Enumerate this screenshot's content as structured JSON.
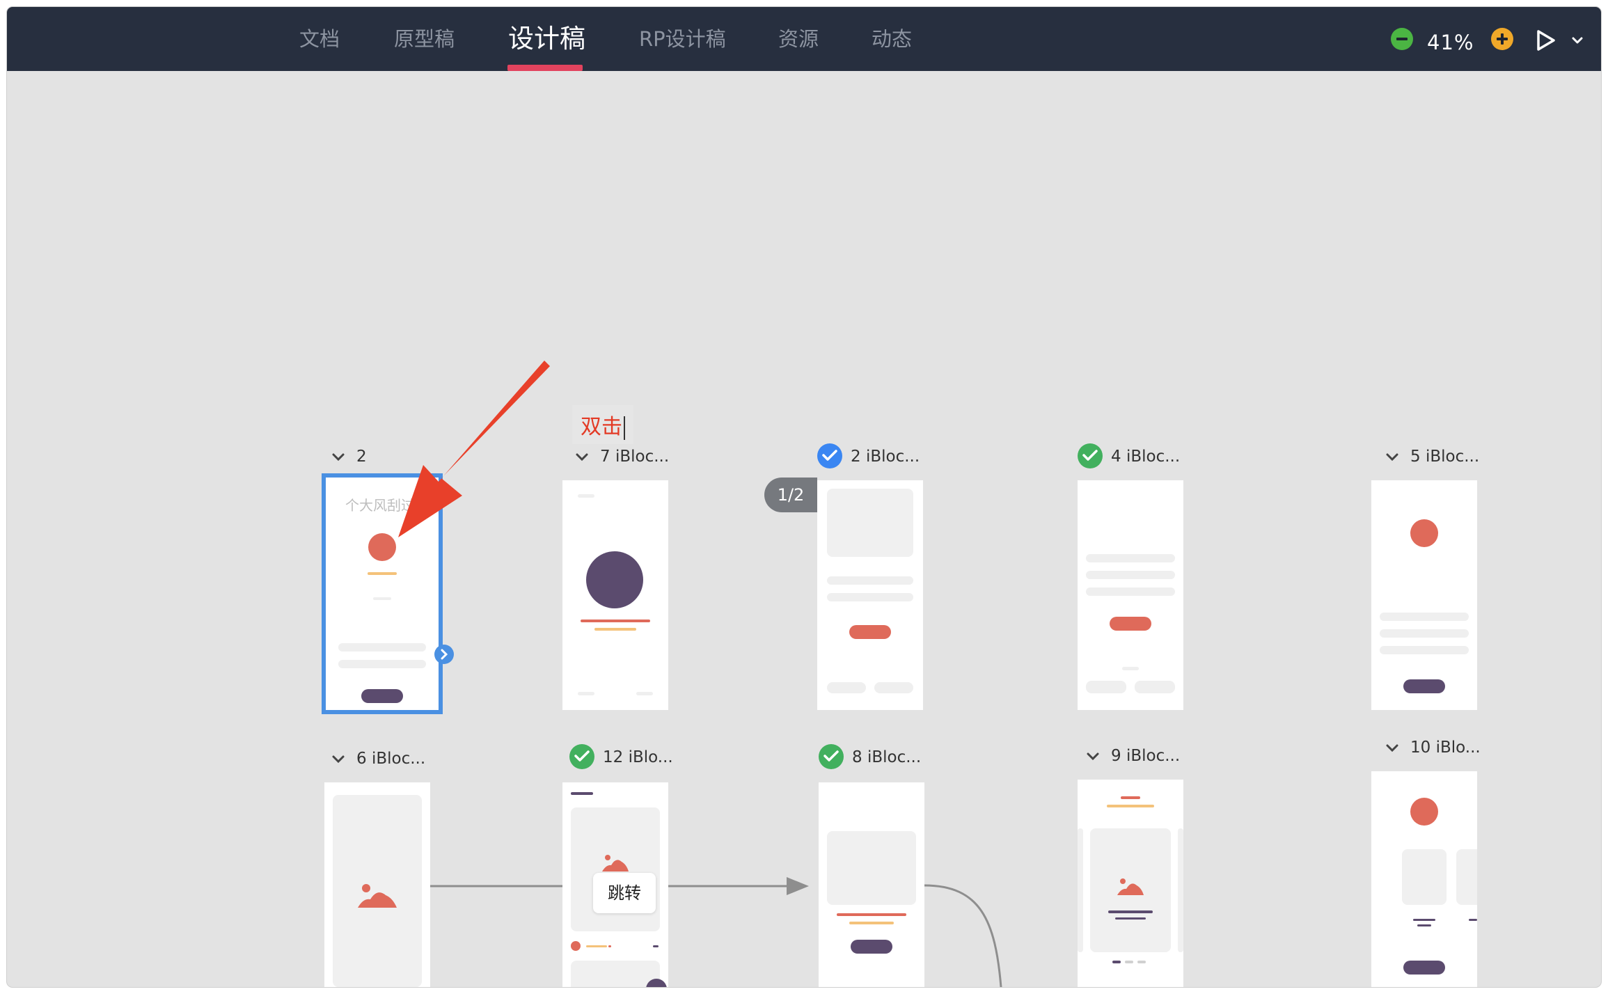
{
  "tabs": [
    {
      "label": "文档",
      "active": false
    },
    {
      "label": "原型稿",
      "active": false
    },
    {
      "label": "设计稿",
      "active": true
    },
    {
      "label": "RP设计稿",
      "active": false
    },
    {
      "label": "资源",
      "active": false
    },
    {
      "label": "动态",
      "active": false
    }
  ],
  "zoom": {
    "value": "41%",
    "minus_icon": "zoom-out-icon",
    "plus_icon": "zoom-in-icon"
  },
  "annotation": {
    "text": "双击",
    "color": "#e33a25"
  },
  "frames": [
    {
      "title": "2",
      "status": "none"
    },
    {
      "title": "7 iBloc...",
      "status": "none"
    },
    {
      "title": "2 iBloc...",
      "status": "checked-blue"
    },
    {
      "title": "4 iBloc...",
      "status": "checked-green"
    },
    {
      "title": "5 iBloc...",
      "status": "none"
    },
    {
      "title": "6 iBloc...",
      "status": "none"
    },
    {
      "title": "12 iBlo...",
      "status": "checked-green"
    },
    {
      "title": "8 iBloc...",
      "status": "checked-green"
    },
    {
      "title": "9 iBloc...",
      "status": "none"
    },
    {
      "title": "10 iBlo...",
      "status": "none"
    }
  ],
  "frame1_text": "个大风刮过",
  "page_indicator": "1/2",
  "link_label": "跳转",
  "colors": {
    "topbar": "#272f3f",
    "accent": "#e2435e",
    "selection": "#4a90e2",
    "coral": "#df6a5a",
    "purple": "#5b4b6e"
  }
}
